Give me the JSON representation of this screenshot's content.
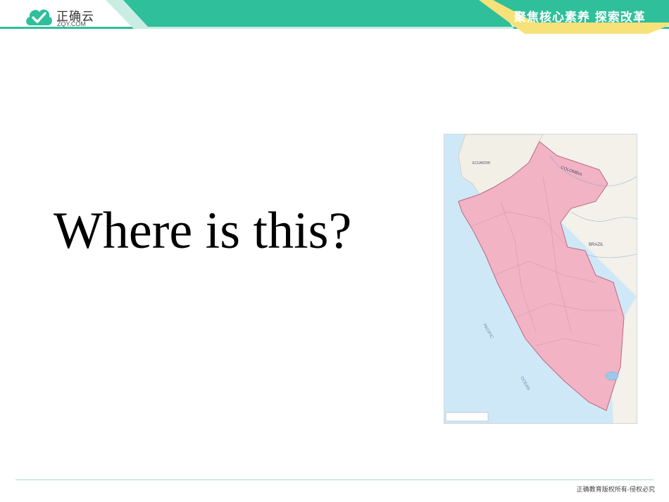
{
  "header": {
    "logo_name": "正确云",
    "logo_domain": "ZQY.COM",
    "slogan": "聚焦核心素养 探索改革",
    "colors": {
      "teal": "#2fbf9b",
      "light_teal": "#c9ede3",
      "yellow": "#f7e27a"
    }
  },
  "slide": {
    "question": "Where is this?"
  },
  "map": {
    "subject": "Peru",
    "labels": {
      "colombia": "COLOMBIA",
      "brazil": "BRAZIL",
      "ecuador": "ECUADOR",
      "pacific": "PACIFIC",
      "ocean": "OCEAN"
    },
    "colors": {
      "land_highlight": "#f2b3c4",
      "ocean": "#cfe8f7",
      "neighbors": "#f4f1ea"
    }
  },
  "footer": {
    "copyright": "正确教育版权所有-侵权必究"
  }
}
